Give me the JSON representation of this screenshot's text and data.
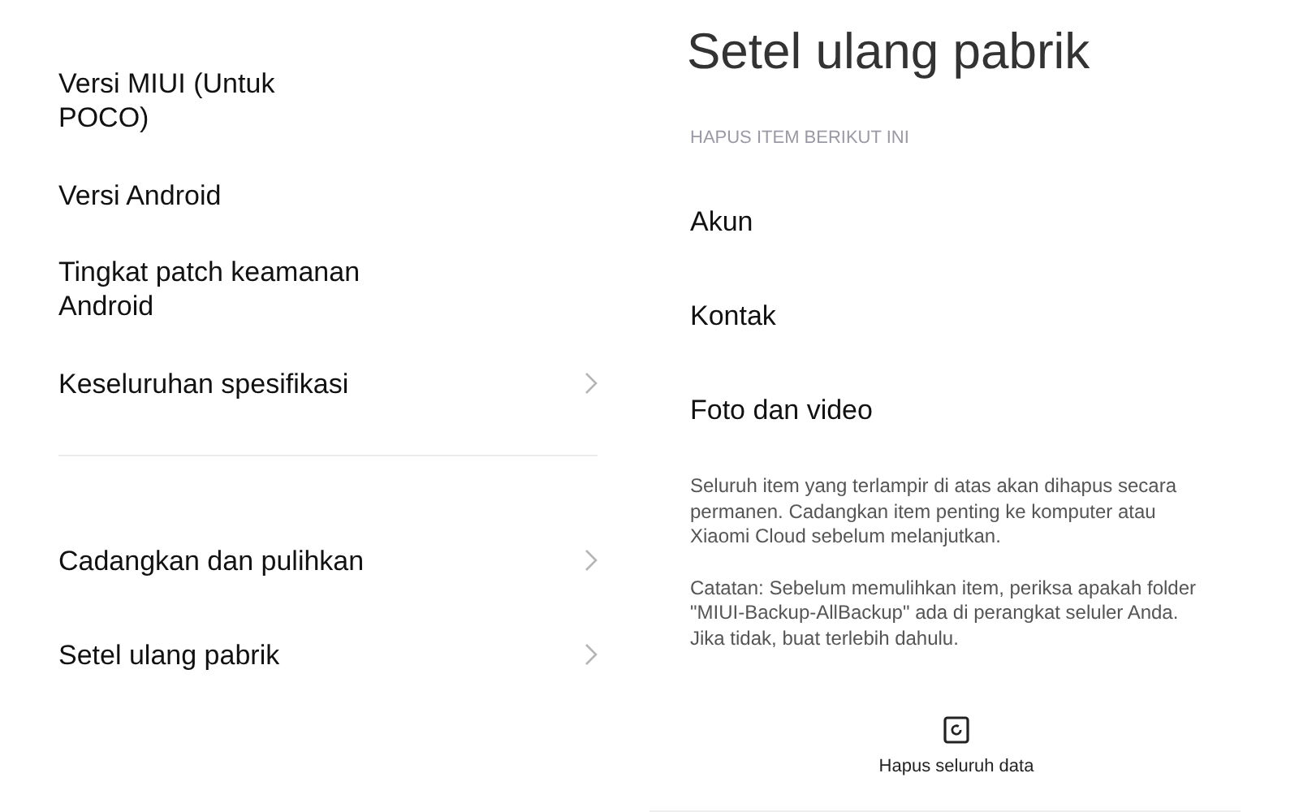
{
  "about_panel": {
    "groups": [
      {
        "items": [
          {
            "label": "Versi MIUI (Untuk\nPOCO)",
            "chevron": false
          },
          {
            "label": "Versi Android",
            "chevron": false
          },
          {
            "label": "Tingkat patch keamanan\nAndroid",
            "chevron": false
          },
          {
            "label": "Keseluruhan spesifikasi",
            "chevron": true
          }
        ]
      },
      {
        "items": [
          {
            "label": "Cadangkan dan pulihkan",
            "chevron": true
          },
          {
            "label": "Setel ulang pabrik",
            "chevron": true
          }
        ]
      }
    ]
  },
  "reset_panel": {
    "title": "Setel ulang pabrik",
    "section_header": "HAPUS ITEM BERIKUT INI",
    "items": [
      "Akun",
      "Kontak",
      "Foto dan video"
    ],
    "notes": [
      "Seluruh item yang terlampir di atas akan dihapus secara permanen. Cadangkan item penting ke komputer atau Xiaomi Cloud sebelum melanjutkan.",
      "Catatan: Sebelum memulihkan item, periksa apakah folder \"MIUI-Backup-AllBackup\" ada di perangkat seluler Anda. Jika tidak, buat terlebih dahulu."
    ],
    "action": {
      "label": "Hapus seluruh data"
    }
  }
}
